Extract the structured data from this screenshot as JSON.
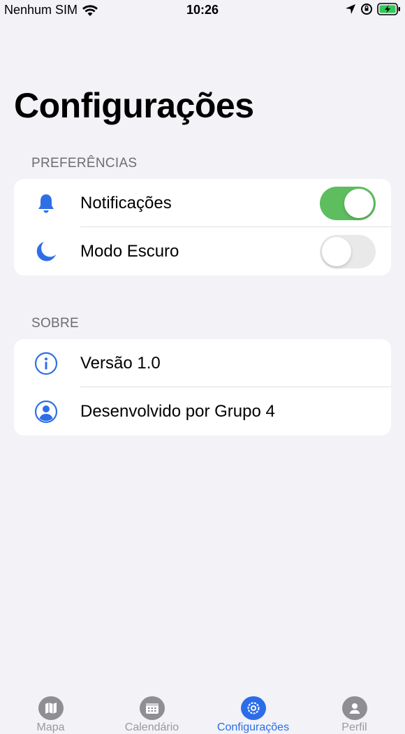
{
  "status_bar": {
    "carrier": "Nenhum SIM",
    "time": "10:26"
  },
  "page": {
    "title": "Configurações"
  },
  "sections": {
    "preferences": {
      "header": "PREFERÊNCIAS",
      "items": [
        {
          "label": "Notificações",
          "icon": "bell-icon",
          "toggle_on": true
        },
        {
          "label": "Modo Escuro",
          "icon": "moon-icon",
          "toggle_on": false
        }
      ]
    },
    "about": {
      "header": "SOBRE",
      "items": [
        {
          "label": "Versão 1.0",
          "icon": "info-icon"
        },
        {
          "label": "Desenvolvido por Grupo 4",
          "icon": "person-circle-icon"
        }
      ]
    }
  },
  "tab_bar": {
    "tabs": [
      {
        "label": "Mapa",
        "icon": "map-icon",
        "active": false
      },
      {
        "label": "Calendário",
        "icon": "calendar-icon",
        "active": false
      },
      {
        "label": "Configurações",
        "icon": "settings-icon",
        "active": true
      },
      {
        "label": "Perfil",
        "icon": "profile-icon",
        "active": false
      }
    ]
  },
  "colors": {
    "accent": "#2b6de8",
    "toggle_on": "#5ebd5e",
    "background": "#f2f2f7",
    "inactive_tab": "#9a9a9e"
  }
}
